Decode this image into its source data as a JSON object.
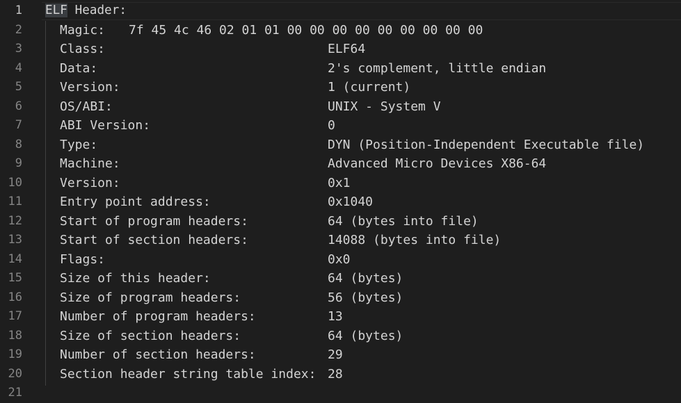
{
  "editor": {
    "header_selected": "ELF",
    "header_rest": " Header:",
    "magic_label": "Magic:",
    "magic_value": "7f 45 4c 46 02 01 01 00 00 00 00 00 00 00 00 00",
    "rows": [
      {
        "key": "Class:",
        "value": "ELF64"
      },
      {
        "key": "Data:",
        "value": "2's complement, little endian"
      },
      {
        "key": "Version:",
        "value": "1 (current)"
      },
      {
        "key": "OS/ABI:",
        "value": "UNIX - System V"
      },
      {
        "key": "ABI Version:",
        "value": "0"
      },
      {
        "key": "Type:",
        "value": "DYN (Position-Independent Executable file)"
      },
      {
        "key": "Machine:",
        "value": "Advanced Micro Devices X86-64"
      },
      {
        "key": "Version:",
        "value": "0x1"
      },
      {
        "key": "Entry point address:",
        "value": "0x1040"
      },
      {
        "key": "Start of program headers:",
        "value": "64 (bytes into file)"
      },
      {
        "key": "Start of section headers:",
        "value": "14088 (bytes into file)"
      },
      {
        "key": "Flags:",
        "value": "0x0"
      },
      {
        "key": "Size of this header:",
        "value": "64 (bytes)"
      },
      {
        "key": "Size of program headers:",
        "value": "56 (bytes)"
      },
      {
        "key": "Number of program headers:",
        "value": "13"
      },
      {
        "key": "Size of section headers:",
        "value": "64 (bytes)"
      },
      {
        "key": "Number of section headers:",
        "value": "29"
      },
      {
        "key": "Section header string table index:",
        "value": "28"
      }
    ],
    "line_numbers": [
      "1",
      "2",
      "3",
      "4",
      "5",
      "6",
      "7",
      "8",
      "9",
      "10",
      "11",
      "12",
      "13",
      "14",
      "15",
      "16",
      "17",
      "18",
      "19",
      "20",
      "21"
    ]
  }
}
